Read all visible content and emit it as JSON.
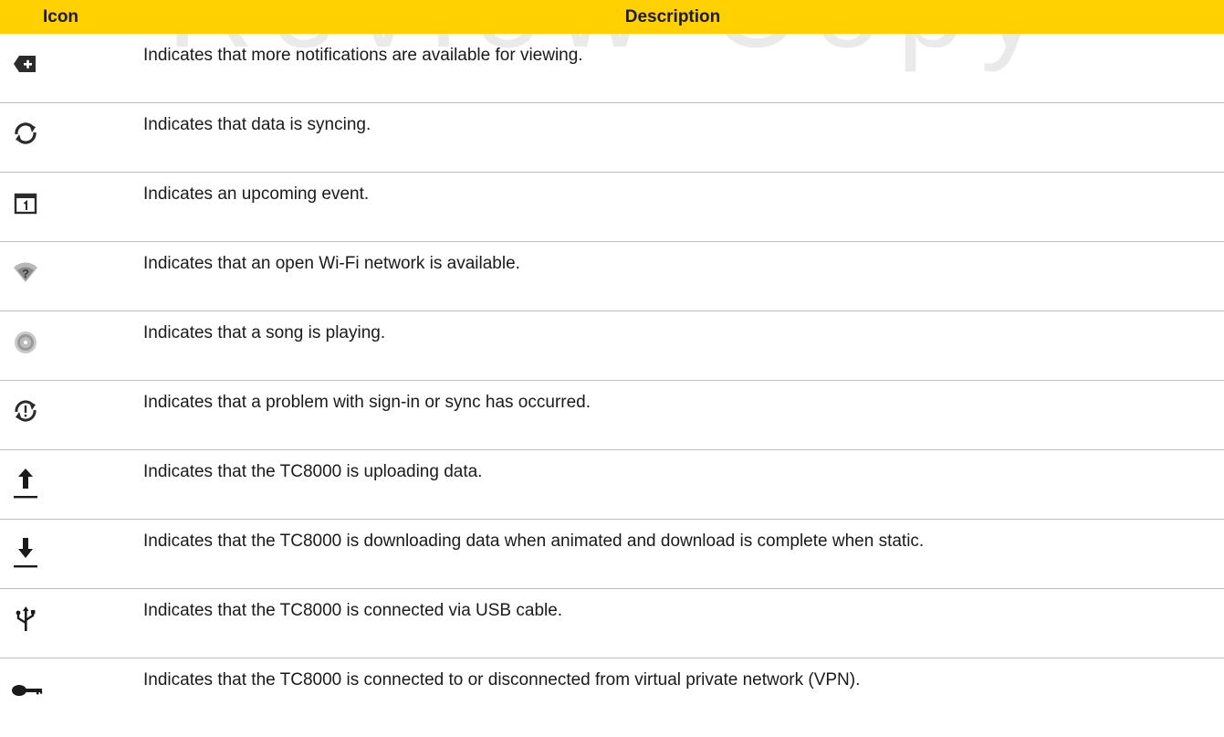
{
  "watermark": "Review Copy",
  "table": {
    "headers": {
      "icon": "Icon",
      "description": "Description"
    },
    "rows": [
      {
        "icon": "more-notifications-icon",
        "description": "Indicates that more notifications are available for viewing."
      },
      {
        "icon": "sync-icon",
        "description": "Indicates that data is syncing."
      },
      {
        "icon": "calendar-event-icon",
        "description": "Indicates an upcoming event."
      },
      {
        "icon": "open-wifi-icon",
        "description": "Indicates that an open Wi-Fi network is available."
      },
      {
        "icon": "song-playing-icon",
        "description": "Indicates that a song is playing."
      },
      {
        "icon": "sync-problem-icon",
        "description": "Indicates that a problem with sign-in or sync has occurred."
      },
      {
        "icon": "upload-icon",
        "description": "Indicates that the TC8000 is uploading data."
      },
      {
        "icon": "download-icon",
        "description": "Indicates that the TC8000 is downloading data when animated and download is complete when static."
      },
      {
        "icon": "usb-icon",
        "description": "Indicates that the TC8000 is connected via USB cable."
      },
      {
        "icon": "vpn-key-icon",
        "description": "Indicates that the TC8000 is connected to or disconnected from virtual private network (VPN)."
      }
    ]
  }
}
